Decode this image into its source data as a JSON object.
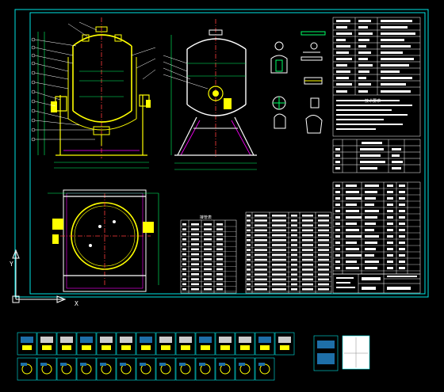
{
  "theme": {
    "background": "#000000",
    "border": "#00e5e5",
    "vessel_outline": "#ffff00",
    "centerline": "#ff3b3b",
    "dimension": "#00ff66",
    "leader": "#ffffff",
    "accent": "#ff00ff",
    "thumb_fill": "#1e6fa8"
  },
  "title_block": {
    "table_heading_left": "接管表",
    "note_header": "技术要求"
  },
  "ucs_icon": {
    "x_axis_label": "X",
    "y_axis_label": "Y"
  },
  "thumbnails": {
    "row1_count": 14,
    "row2_count": 13,
    "extra_count": 2
  }
}
